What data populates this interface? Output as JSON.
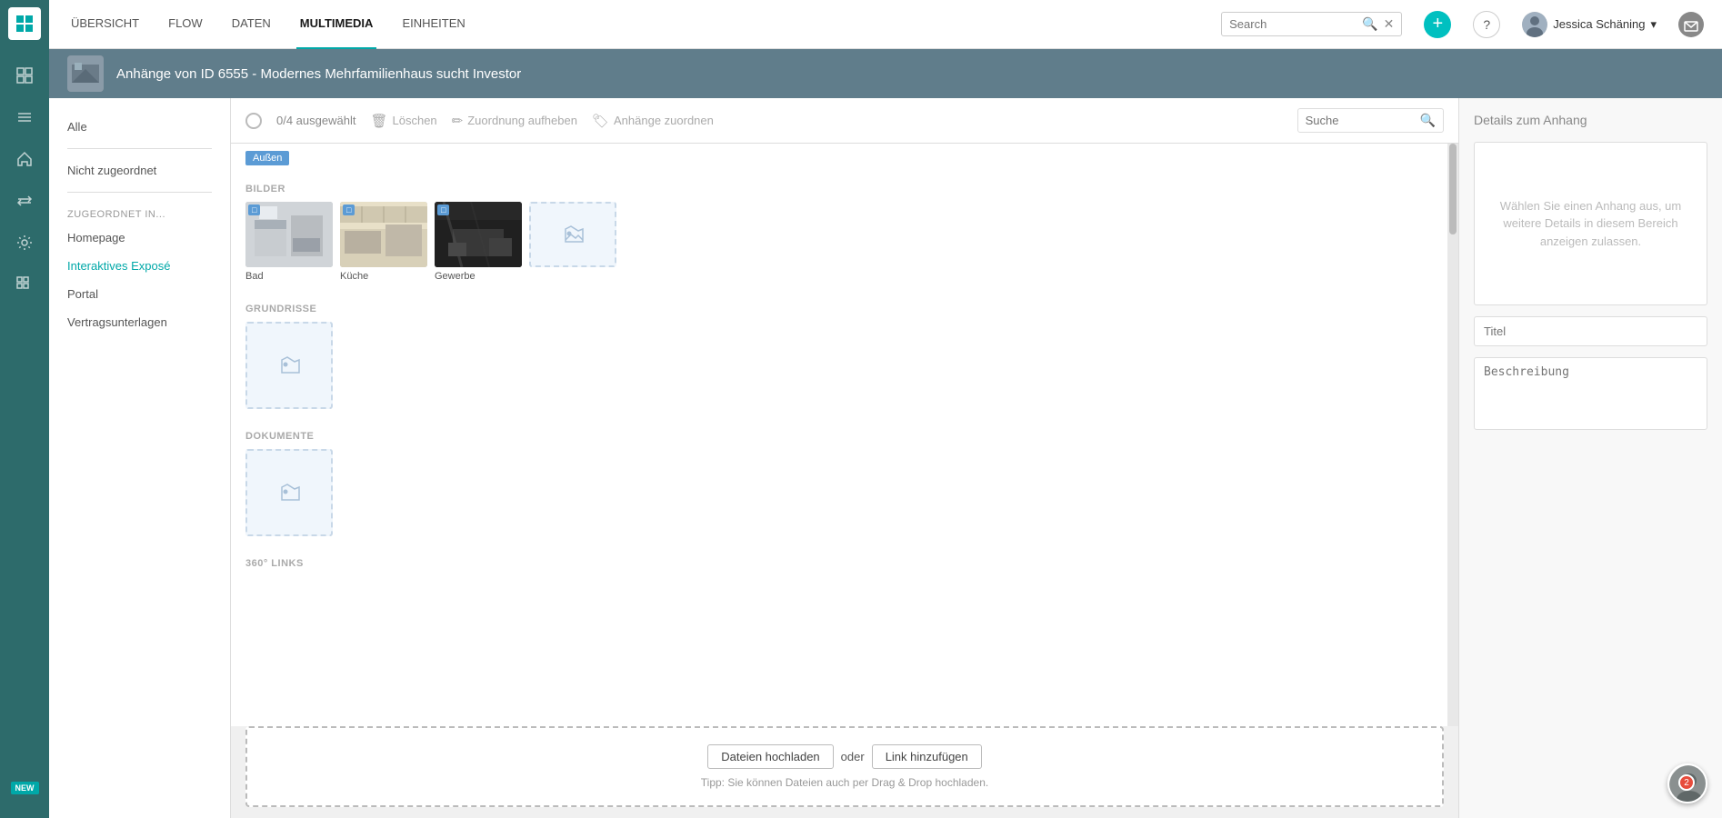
{
  "sidebar": {
    "icons": [
      {
        "name": "logo",
        "symbol": "◈"
      },
      {
        "name": "grid-icon",
        "symbol": "⊞"
      },
      {
        "name": "list-icon",
        "symbol": "≡"
      },
      {
        "name": "home-icon",
        "symbol": "⌂"
      },
      {
        "name": "transfer-icon",
        "symbol": "⇄"
      },
      {
        "name": "settings-icon",
        "symbol": "⚙"
      },
      {
        "name": "apps-icon",
        "symbol": "⊞"
      }
    ]
  },
  "topnav": {
    "items": [
      {
        "label": "ÜBERSICHT",
        "active": false
      },
      {
        "label": "FLOW",
        "active": false
      },
      {
        "label": "DATEN",
        "active": false
      },
      {
        "label": "MULTIMEDIA",
        "active": true
      },
      {
        "label": "EINHEITEN",
        "active": false
      }
    ],
    "search_placeholder": "Search",
    "user_name": "Jessica Schäning",
    "add_button_label": "+",
    "help_label": "?"
  },
  "page_header": {
    "title": "Anhänge von ID 6555 - Modernes Mehrfamilienhaus sucht Investor"
  },
  "toolbar": {
    "selected_count": "0/4 ausgewählt",
    "delete_label": "Löschen",
    "unassign_label": "Zuordnung aufheben",
    "assign_label": "Anhänge zuordnen",
    "search_placeholder": "Suche"
  },
  "left_nav": {
    "items": [
      {
        "label": "Alle",
        "active": false
      },
      {
        "label": "Nicht zugeordnet",
        "active": false
      }
    ],
    "section_title": "ZUGEORDNET IN...",
    "assigned_items": [
      {
        "label": "Homepage",
        "active": false
      },
      {
        "label": "Interaktives Exposé",
        "active": true
      },
      {
        "label": "Portal",
        "active": false
      },
      {
        "label": "Vertragsunterlagen",
        "active": false
      }
    ]
  },
  "media_sections": {
    "outside_tag": "Außen",
    "bilder_label": "BILDER",
    "bilder_items": [
      {
        "label": "Bad",
        "tag": "□"
      },
      {
        "label": "Küche",
        "tag": "□"
      },
      {
        "label": "Gewerbe",
        "tag": "□"
      }
    ],
    "grundrisse_label": "GRUNDRISSE",
    "dokumente_label": "DOKUMENTE",
    "links_label": "360° LINKS"
  },
  "right_panel": {
    "title": "Details zum Anhang",
    "placeholder_text": "Wählen Sie einen Anhang aus, um weitere Details in diesem Bereich anzeigen zulassen.",
    "title_placeholder": "Titel",
    "description_placeholder": "Beschreibung"
  },
  "upload_zone": {
    "upload_btn_label": "Dateien hochladen",
    "or_label": "oder",
    "link_btn_label": "Link hinzufügen",
    "tip_text": "Tipp: Sie können Dateien auch per Drag & Drop hochladen."
  },
  "colors": {
    "sidebar_bg": "#2d6b6b",
    "accent": "#00a8a8",
    "tag_blue": "#5b9bd5",
    "active_nav": "#00a8a8",
    "header_bg": "#607d8b"
  }
}
